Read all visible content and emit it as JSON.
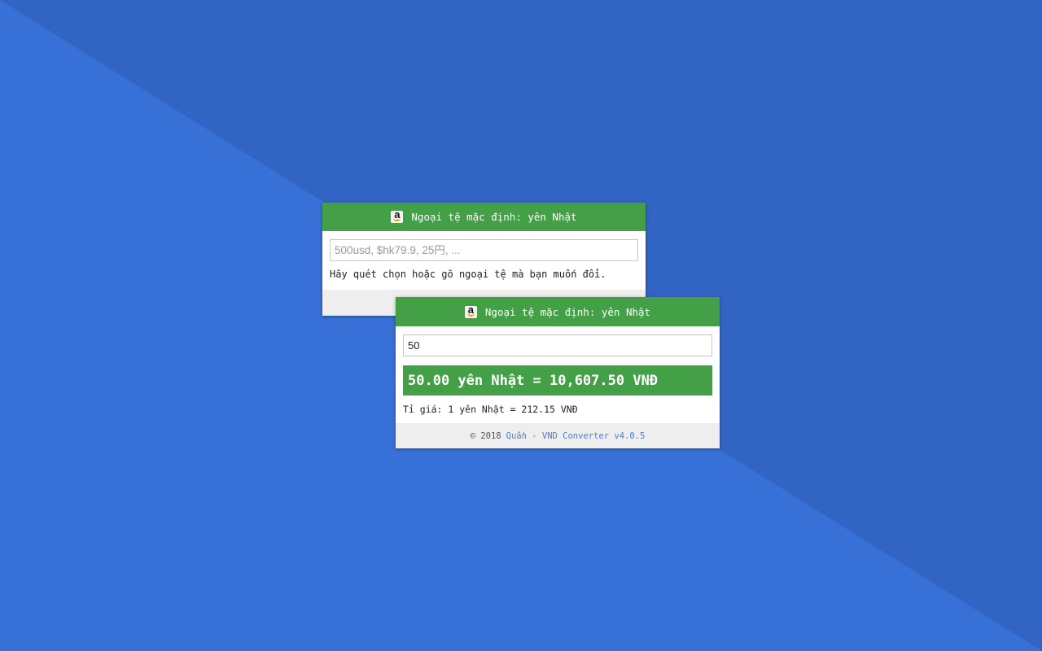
{
  "colors": {
    "background_light": "#3770d6",
    "background_dark": "#3264c4",
    "header_green": "#43a047",
    "footer_gray": "#eeeeee",
    "link_blue": "#4a7fd8"
  },
  "back_popup": {
    "header": {
      "icon": "amazon-icon",
      "title": "Ngoại tệ mặc định: yên Nhật"
    },
    "input": {
      "value": "",
      "placeholder": "500usd, $hk79.9, 25円, ..."
    },
    "hint": "Hãy quét chọn hoặc gõ ngoại tệ mà bạn muốn đổi."
  },
  "front_popup": {
    "header": {
      "icon": "amazon-icon",
      "title": "Ngoại tệ mặc định: yên Nhật"
    },
    "input": {
      "value": "50"
    },
    "result": "50.00 yên Nhật = 10,607.50 VNĐ",
    "rate": "Tỉ giá: 1 yên Nhật = 212.15 VNĐ",
    "footer": {
      "copyright": "© 2018",
      "link_text": "Quần - VND Converter v4.0.5"
    }
  }
}
